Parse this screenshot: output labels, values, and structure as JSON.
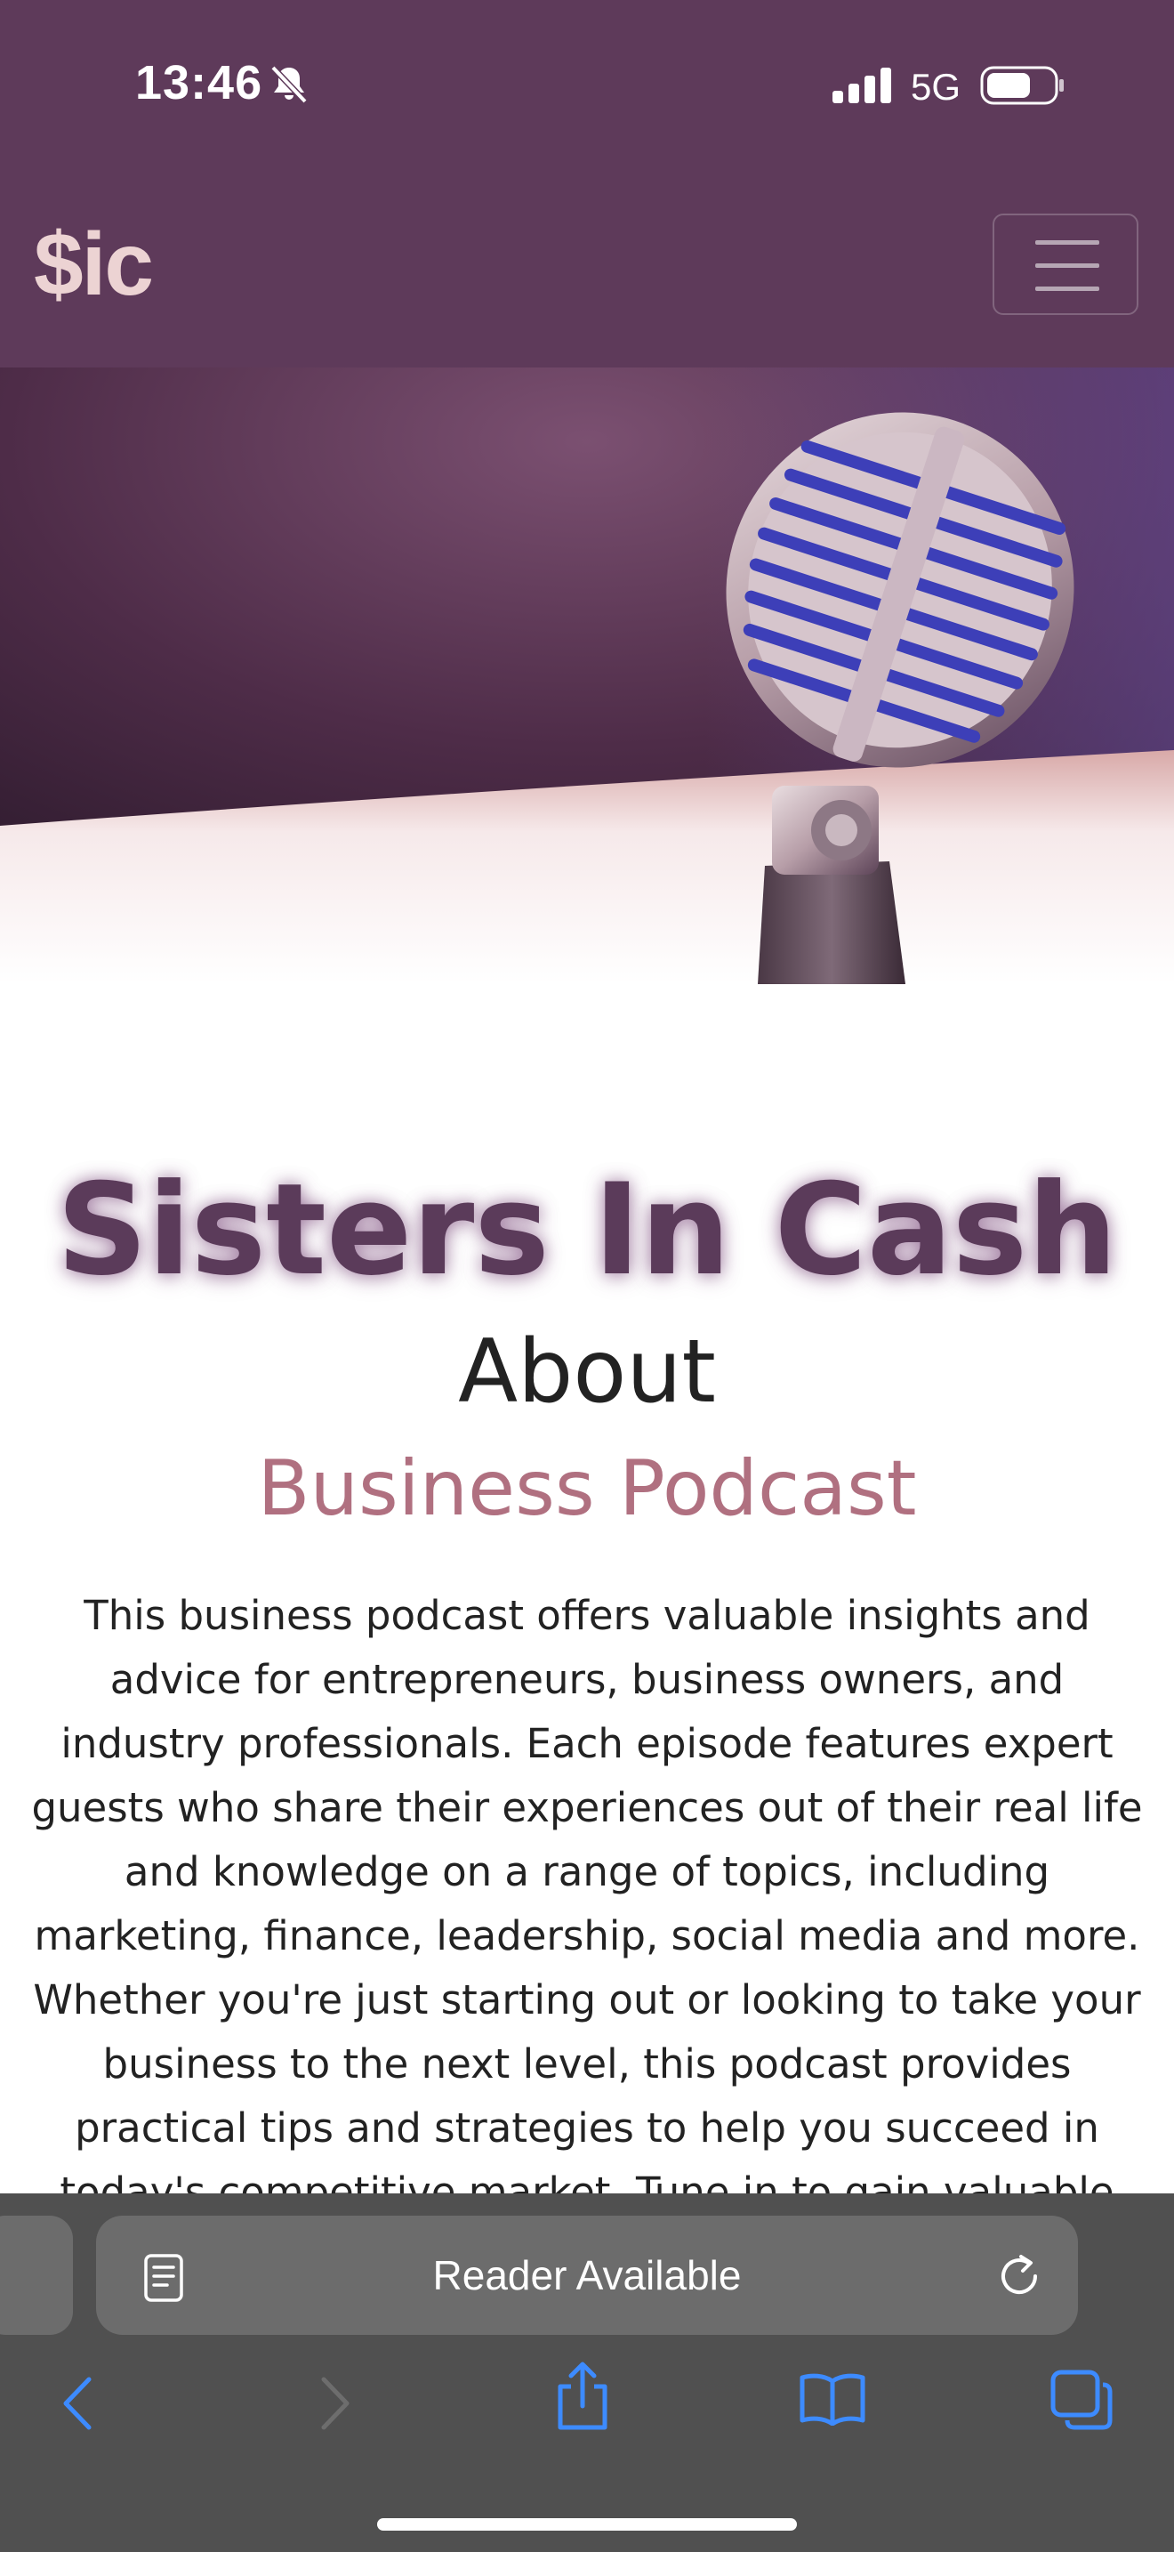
{
  "status_bar": {
    "time": "13:46",
    "network": "5G"
  },
  "navbar": {
    "brand": "$ic"
  },
  "content": {
    "title": "Sisters In Cash",
    "about": "About",
    "subtitle": "Business Podcast",
    "body_lines": [
      "This business podcast offers valuable insights and",
      "advice for entrepreneurs, business owners, and",
      "industry professionals. Each episode features expert",
      "guests who share their experiences out of their real life",
      "and knowledge on a range of topics, including",
      "marketing, finance, leadership, social media and more.",
      "Whether you're just starting out or looking to take your",
      "business to the next level, this podcast provides",
      "practical tips and strategies to help you succeed in",
      "today's competitive market. Tune in to gain valuable"
    ]
  },
  "browser": {
    "address_text": "Reader Available"
  },
  "colors": {
    "brand_bar": "#5e3a5a",
    "title": "#5b3b5a",
    "subtitle": "#b07080",
    "toolbar_icon": "#3d8bff"
  }
}
